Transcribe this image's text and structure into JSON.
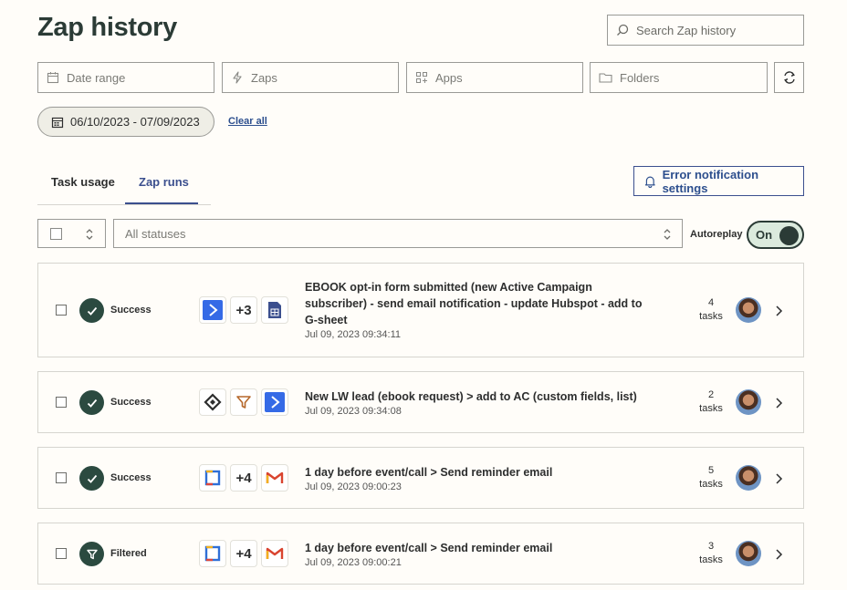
{
  "page": {
    "title": "Zap history"
  },
  "search": {
    "placeholder": "Search Zap history"
  },
  "filters": {
    "date_range": "Date range",
    "zaps": "Zaps",
    "apps": "Apps",
    "folders": "Folders"
  },
  "active_filter": {
    "date_chip": "06/10/2023 - 07/09/2023",
    "clear_all": "Clear all"
  },
  "tabs": [
    {
      "label": "Task usage",
      "active": false
    },
    {
      "label": "Zap runs",
      "active": true
    }
  ],
  "error_settings_label": "Error notification settings",
  "status_select": {
    "value": "All statuses"
  },
  "autoreplay": {
    "label": "Autoreplay",
    "state": "On"
  },
  "runs": [
    {
      "status": "Success",
      "apps": [
        "activecampaign-icon",
        "+3",
        "google-sheets-icon"
      ],
      "name": "EBOOK opt-in form submitted (new Active Campaign subscriber) - send email notification - update Hubspot - add to G-sheet",
      "time": "Jul 09, 2023 09:34:11",
      "tasks_count": "4",
      "tasks_label": "tasks"
    },
    {
      "status": "Success",
      "apps": [
        "webhook-icon",
        "filter-icon",
        "activecampaign-icon"
      ],
      "name": "New LW lead (ebook request) > add to AC (custom fields, list)",
      "time": "Jul 09, 2023 09:34:08",
      "tasks_count": "2",
      "tasks_label": "tasks"
    },
    {
      "status": "Success",
      "apps": [
        "calendar-app-icon",
        "+4",
        "gmail-icon"
      ],
      "name": "1 day before event/call > Send reminder email",
      "time": "Jul 09, 2023 09:00:23",
      "tasks_count": "5",
      "tasks_label": "tasks"
    },
    {
      "status": "Filtered",
      "apps": [
        "calendar-app-icon",
        "+4",
        "gmail-icon"
      ],
      "name": "1 day before event/call > Send reminder email",
      "time": "Jul 09, 2023 09:00:21",
      "tasks_count": "3",
      "tasks_label": "tasks"
    }
  ],
  "colors": {
    "brand_dark": "#2b3b36",
    "link_blue": "#2d4f8e",
    "background": "#fffdf9",
    "activecampaign_blue": "#356ae6"
  }
}
